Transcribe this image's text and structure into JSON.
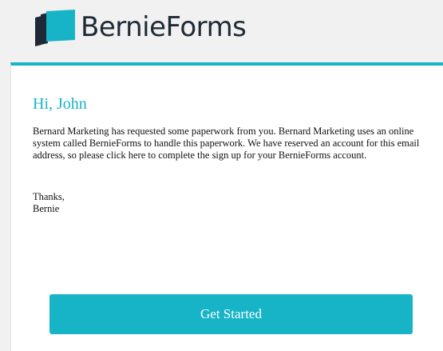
{
  "brand": {
    "name": "BernieForms",
    "logo_icon": "stacked-pages-logo",
    "logo_colors": [
      "#17b4c8",
      "#1f2a36"
    ]
  },
  "email": {
    "greeting": "Hi, John",
    "body": "Bernard Marketing has requested some paperwork from you. Bernard Marketing uses an online system called BernieForms to handle this paperwork. We have reserved an account for this email address, so please click here to complete the sign up for your BernieForms account.",
    "signoff_line1": "Thanks,",
    "signoff_line2": "Bernie",
    "cta_label": "Get Started"
  },
  "colors": {
    "accent": "#17b4c8",
    "background": "#f1f1f1",
    "card": "#ffffff",
    "text": "#111111"
  }
}
